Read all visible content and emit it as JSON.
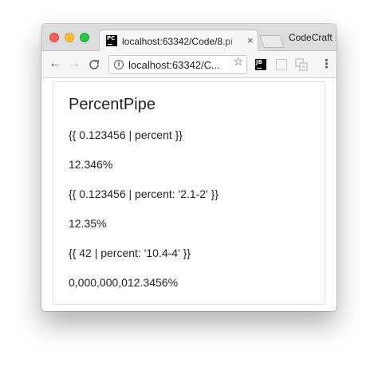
{
  "browser": {
    "tab_title": "localhost:63342/Code/8.pi",
    "tab_close": "×",
    "favicon_text": "PC",
    "profile_name": "CodeCraft",
    "url": "localhost:63342/C...",
    "info_icon_text": "i",
    "nav": {
      "back": "←",
      "forward": "→",
      "reload": "C"
    },
    "star": "☆",
    "extensions": {
      "jb_text": "JB"
    },
    "menu": "⋮"
  },
  "page": {
    "title": "PercentPipe",
    "lines": [
      "{{ 0.123456 | percent }}",
      "12.346%",
      "{{ 0.123456 | percent: '2.1-2' }}",
      "12.35%",
      "{{ 42 | percent: '10.4-4' }}",
      "0,000,000,012.3456%"
    ]
  },
  "colors": {
    "close": "#fc5f57",
    "minimize": "#fdbc2e",
    "maximize": "#28c840",
    "titlebar": "#dcdcdc",
    "toolbar": "#f6f6f6"
  }
}
